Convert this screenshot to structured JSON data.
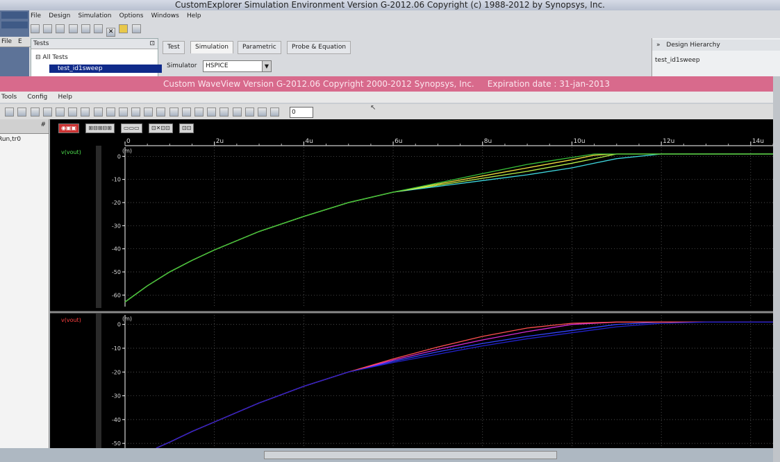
{
  "customexplorer": {
    "title": "CustomExplorer Simulation Environment Version G-2012.06 Copyright (c) 1988-2012 by Synopsys, Inc.",
    "menu": [
      "File",
      "Design",
      "Simulation",
      "Options",
      "Windows",
      "Help"
    ],
    "left_menu": [
      "File",
      "E"
    ],
    "tests_panel": {
      "label": "Tests",
      "tree_root": "All Tests",
      "selected_item": "test_id1sweep"
    },
    "tabs": [
      {
        "label": "Test"
      },
      {
        "label": "Simulation"
      },
      {
        "label": "Parametric"
      },
      {
        "label": "Probe & Equation"
      }
    ],
    "simulator_label": "Simulator",
    "simulator_value": "HSPICE",
    "design_hierarchy": {
      "label": "Design Hierarchy",
      "item": "test_id1sweep"
    }
  },
  "waveview": {
    "title": "Custom WaveView Version G-2012.06 Copyright 2000-2012 Synopsys, Inc.     Expiration date : 31-jan-2013",
    "menu": [
      "Tools",
      "Config",
      "Help"
    ],
    "x_input_value": "0",
    "left_panel_item": "Run,tr0"
  },
  "colors": {
    "wv_title_bg": "#d86a8c",
    "plot_bg": "#000000",
    "series_top": [
      "#3fd9e0",
      "#b6f04a",
      "#f0e040",
      "#39c23a"
    ],
    "series_bottom": [
      "#3344ff",
      "#d42bd4",
      "#ff5050",
      "#2222cc"
    ]
  },
  "chart_data": {
    "type": "line",
    "x_tick_labels": [
      "0",
      "2u",
      "4u",
      "6u",
      "8u",
      "10u",
      "12u",
      "14u"
    ],
    "x_ticks": [
      0,
      2,
      4,
      6,
      8,
      10,
      12,
      14
    ],
    "xlim": [
      0,
      14.5
    ],
    "panels": [
      {
        "label": "v(vout)",
        "unit_label": "(m)",
        "y_tick_labels": [
          "0",
          "-10",
          "-20",
          "-30",
          "-40",
          "-50",
          "-60"
        ],
        "y_ticks": [
          0,
          -10,
          -20,
          -30,
          -40,
          -50,
          -60
        ],
        "ylim": [
          -65,
          4
        ],
        "series": [
          {
            "x": [
              0,
              0.5,
              1,
              1.5,
              2,
              3,
              4,
              5,
              6,
              7,
              8,
              9,
              10,
              10.5,
              11,
              12,
              13,
              14.5
            ],
            "y": [
              -63,
              -56,
              -50,
              -45,
              -40.5,
              -32.5,
              -26,
              -20,
              -15.5,
              -13,
              -10.5,
              -8,
              -5,
              -3,
              -1,
              1,
              1,
              1
            ]
          },
          {
            "x": [
              0,
              0.5,
              1,
              1.5,
              2,
              3,
              4,
              5,
              6,
              7,
              8,
              9,
              10,
              10.5,
              11,
              12,
              13,
              14.5
            ],
            "y": [
              -63,
              -56,
              -50,
              -45,
              -40.5,
              -32.5,
              -26,
              -20,
              -15.5,
              -12.5,
              -9.5,
              -6.5,
              -3,
              -1,
              1,
              1,
              1,
              1
            ]
          },
          {
            "x": [
              0,
              0.5,
              1,
              1.5,
              2,
              3,
              4,
              5,
              6,
              7,
              8,
              9,
              10,
              10.5,
              11,
              12,
              13,
              14.5
            ],
            "y": [
              -63,
              -56,
              -50,
              -45,
              -40.5,
              -32.5,
              -26,
              -20,
              -15.5,
              -12,
              -8.5,
              -5,
              -1.5,
              0.5,
              1,
              1,
              1,
              1
            ]
          },
          {
            "x": [
              0,
              0.5,
              1,
              1.5,
              2,
              3,
              4,
              5,
              6,
              7,
              8,
              9,
              10,
              10.5,
              11,
              12,
              13,
              14.5
            ],
            "y": [
              -63,
              -56,
              -50,
              -45,
              -40.5,
              -32.5,
              -26,
              -20,
              -15.5,
              -11.5,
              -7.5,
              -3.5,
              -0.5,
              1,
              1,
              1,
              1,
              1
            ]
          }
        ]
      },
      {
        "label": "v(vout)",
        "unit_label": "(m)",
        "y_tick_labels": [
          "0",
          "-10",
          "-20",
          "-30",
          "-40",
          "-50"
        ],
        "y_ticks": [
          0,
          -10,
          -20,
          -30,
          -40,
          -50
        ],
        "ylim": [
          -52,
          4
        ],
        "series": [
          {
            "x": [
              0.7,
              1,
              1.5,
              2,
              3,
              4,
              5,
              6,
              7,
              8,
              9,
              10,
              11,
              12,
              13,
              14.5
            ],
            "y": [
              -52,
              -49.5,
              -45,
              -41,
              -33,
              -26,
              -20,
              -15.5,
              -11.5,
              -8,
              -5,
              -2.5,
              0,
              1,
              1,
              1
            ]
          },
          {
            "x": [
              0.7,
              1,
              1.5,
              2,
              3,
              4,
              5,
              6,
              7,
              8,
              9,
              10,
              11,
              12,
              13,
              14.5
            ],
            "y": [
              -52,
              -49.5,
              -45,
              -41,
              -33,
              -26,
              -20,
              -15,
              -10.5,
              -6.5,
              -3,
              0,
              1,
              1,
              1,
              1
            ]
          },
          {
            "x": [
              0.7,
              1,
              1.5,
              2,
              3,
              4,
              5,
              6,
              7,
              8,
              9,
              10,
              11,
              12,
              13,
              14.5
            ],
            "y": [
              -52,
              -49.5,
              -45,
              -41,
              -33,
              -26,
              -20,
              -14.5,
              -9.5,
              -5,
              -1.5,
              0.5,
              1,
              1,
              1,
              1
            ]
          },
          {
            "x": [
              0.7,
              1,
              1.5,
              2,
              3,
              4,
              5,
              6,
              7,
              8,
              9,
              10,
              11,
              12,
              13,
              14.5
            ],
            "y": [
              -52,
              -49.5,
              -45,
              -41,
              -33,
              -26,
              -20,
              -16,
              -12.5,
              -9,
              -6,
              -3.5,
              -1,
              0.5,
              1,
              1
            ]
          }
        ]
      }
    ]
  }
}
